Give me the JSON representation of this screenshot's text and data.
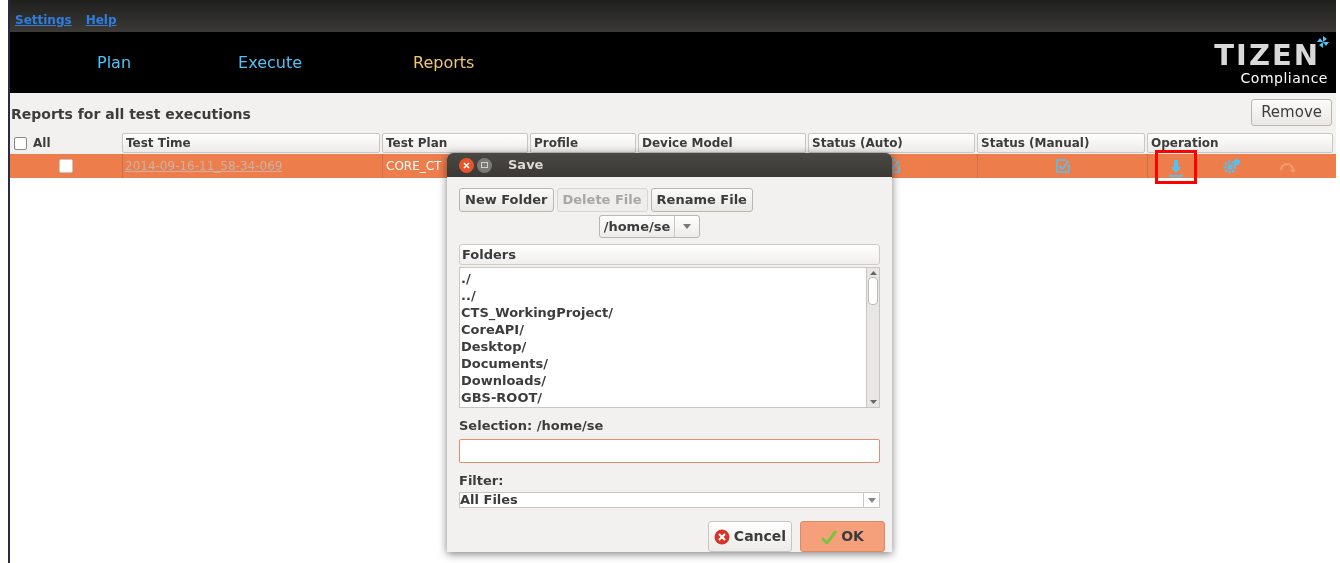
{
  "menu": [
    {
      "label": "Settings"
    },
    {
      "label": "Help"
    }
  ],
  "tabs": [
    {
      "label": "Plan",
      "selected": false
    },
    {
      "label": "Execute",
      "selected": false
    },
    {
      "label": "Reports",
      "selected": true
    }
  ],
  "logo": {
    "title": "TIZEN",
    "subtitle": "Compliance"
  },
  "reports": {
    "title": "Reports for all test executions",
    "remove_button": "Remove",
    "select_all": {
      "label": "All",
      "checked": false
    },
    "columns": [
      "Test Time",
      "Test Plan",
      "Profile",
      "Device Model",
      "Status (Auto)",
      "Status (Manual)",
      "Operation"
    ],
    "rows": [
      {
        "selected": true,
        "checked": false,
        "test_time": "2014-09-16-11_58-34-069",
        "test_plan": "CORE_CT",
        "operations": [
          {
            "kind": "download",
            "highlighted": true
          },
          {
            "kind": "settings",
            "highlighted": false
          },
          {
            "kind": "undo",
            "highlighted": false
          }
        ]
      }
    ]
  },
  "dialog": {
    "title": "Save",
    "buttons": [
      {
        "label": "New Folder",
        "disabled": false
      },
      {
        "label": "Delete File",
        "disabled": true
      },
      {
        "label": "Rename File",
        "disabled": false
      }
    ],
    "path": "/home/se",
    "folders_header": "Folders",
    "folders": [
      "./",
      "../",
      "CTS_WorkingProject/",
      "CoreAPI/",
      "Desktop/",
      "Documents/",
      "Downloads/",
      "GBS-ROOT/"
    ],
    "selection_label": "Selection: /home/se",
    "filter_label": "Filter:",
    "filter_value": "All Files",
    "actions": [
      {
        "label": "Cancel",
        "kind": "cancel"
      },
      {
        "label": "OK",
        "kind": "ok"
      }
    ]
  }
}
